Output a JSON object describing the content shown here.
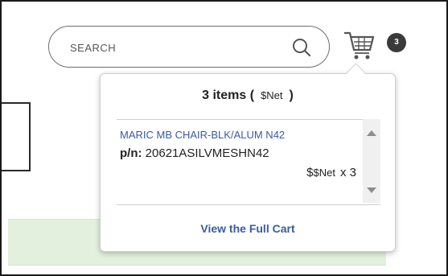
{
  "search": {
    "placeholder": "SEARCH"
  },
  "icons": {
    "search": "search-icon",
    "cart": "cart-icon",
    "scroll_up": "chevron-up-icon",
    "scroll_down": "chevron-down-icon"
  },
  "cart": {
    "badge_count": "3",
    "dropdown": {
      "header_prefix": "3 items (",
      "header_net": "$Net",
      "header_suffix": ")",
      "items": [
        {
          "name": "MARIC MB CHAIR-BLK/ALUM N42",
          "pn_label": "p/n:",
          "pn_value": "20621ASILVMESHN42",
          "price_prefix": "$",
          "price_net": "$Net",
          "quantity": "x 3"
        }
      ],
      "view_full_cart_label": "View the Full Cart"
    }
  },
  "colors": {
    "link_blue": "#3b5b9e",
    "badge_bg": "#3a3a3a",
    "band_green": "#e3f0de"
  }
}
